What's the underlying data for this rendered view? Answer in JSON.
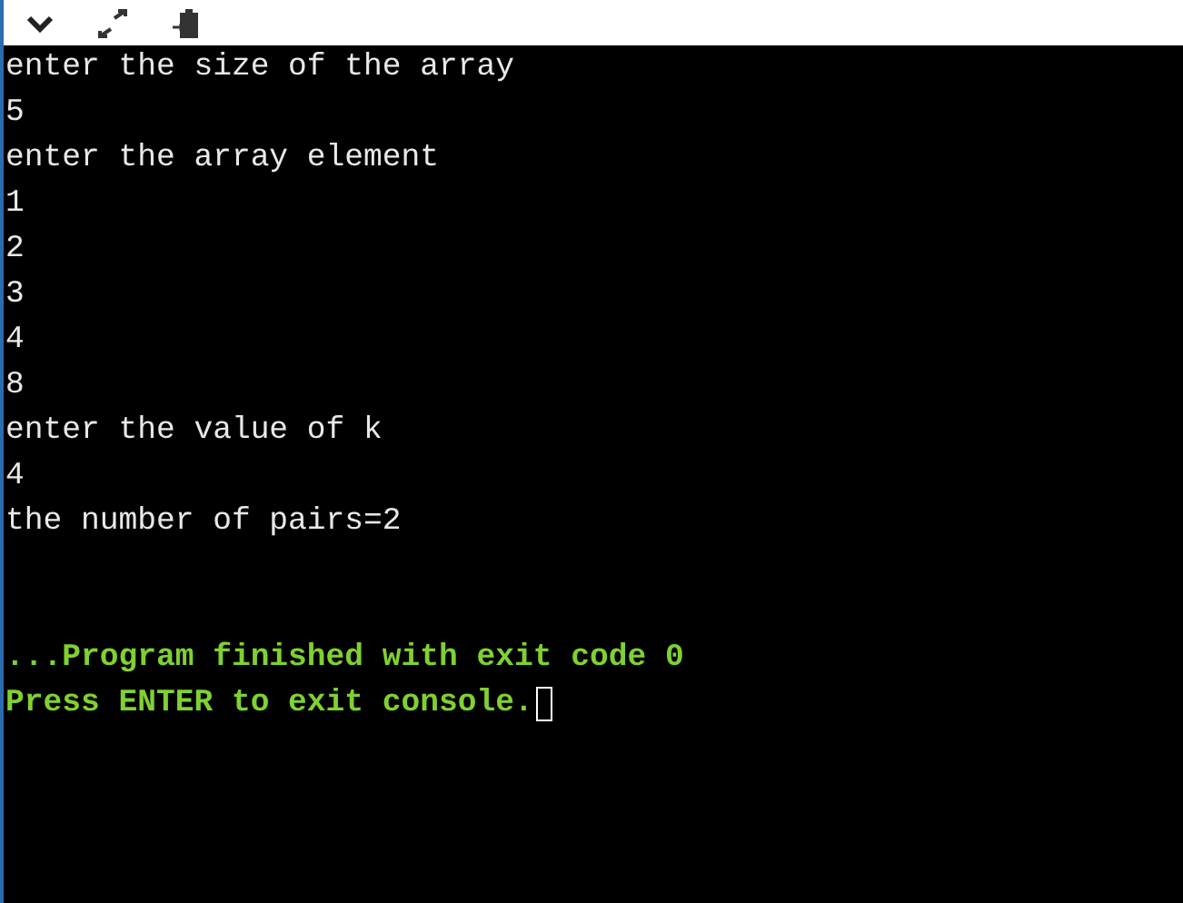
{
  "lines": [
    {
      "kind": "output",
      "text": "enter the size of the array",
      "cursor": false
    },
    {
      "kind": "output",
      "text": "5",
      "cursor": false
    },
    {
      "kind": "output",
      "text": "enter the array element",
      "cursor": false
    },
    {
      "kind": "output",
      "text": "1",
      "cursor": false
    },
    {
      "kind": "output",
      "text": "2",
      "cursor": false
    },
    {
      "kind": "output",
      "text": "3",
      "cursor": false
    },
    {
      "kind": "output",
      "text": "4",
      "cursor": false
    },
    {
      "kind": "output",
      "text": "8",
      "cursor": false
    },
    {
      "kind": "output",
      "text": "enter the value of k",
      "cursor": false
    },
    {
      "kind": "output",
      "text": "4",
      "cursor": false
    },
    {
      "kind": "output",
      "text": "the number of pairs=2",
      "cursor": false
    },
    {
      "kind": "status",
      "text": "...Program finished with exit code 0",
      "cursor": false
    },
    {
      "kind": "status",
      "text": "Press ENTER to exit console.",
      "cursor": true
    }
  ]
}
